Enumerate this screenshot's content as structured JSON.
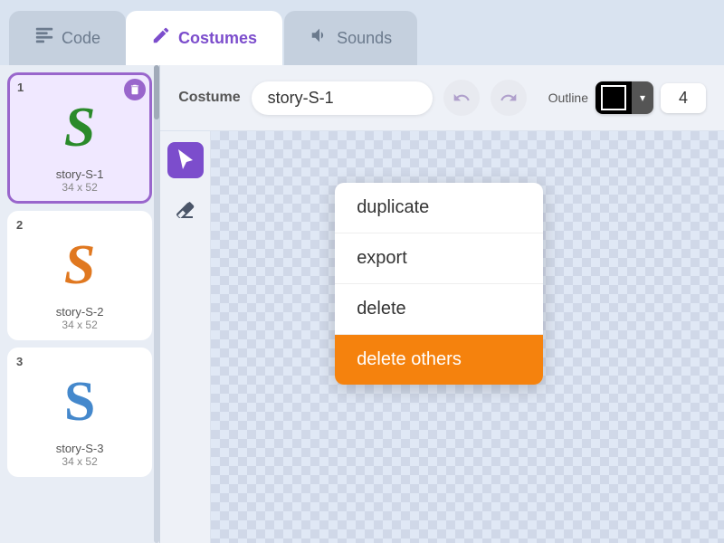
{
  "tabs": {
    "code": {
      "label": "Code",
      "icon": "≡"
    },
    "costumes": {
      "label": "Costumes",
      "icon": "✏"
    },
    "sounds": {
      "label": "Sounds",
      "icon": "🔊"
    }
  },
  "costume_toolbar": {
    "label": "Costume",
    "name_value": "story-S-1",
    "outline_label": "Outline",
    "outline_value": "4"
  },
  "costumes": [
    {
      "number": "1",
      "name": "story-S-1",
      "size": "34 x 52",
      "selected": true
    },
    {
      "number": "2",
      "name": "story-S-2",
      "size": "34 x 52",
      "selected": false
    },
    {
      "number": "3",
      "name": "story-S-3",
      "size": "34 x 52",
      "selected": false
    }
  ],
  "context_menu": {
    "items": [
      {
        "label": "duplicate",
        "highlight": false
      },
      {
        "label": "export",
        "highlight": false
      },
      {
        "label": "delete",
        "highlight": false
      },
      {
        "label": "delete others",
        "highlight": true
      }
    ]
  },
  "tools": [
    {
      "name": "select",
      "icon": "⬡",
      "active": true
    },
    {
      "name": "eraser",
      "icon": "◆",
      "active": false
    }
  ]
}
